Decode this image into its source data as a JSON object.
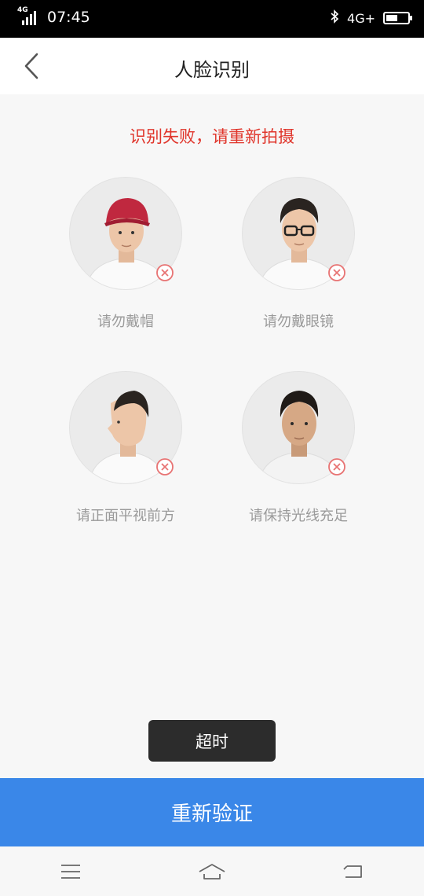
{
  "status_bar": {
    "network_left": "4G",
    "time": "07:45",
    "network_right": "4G+",
    "battery_level": 0.55
  },
  "nav": {
    "title": "人脸识别"
  },
  "error_message": "识别失败，请重新拍摄",
  "tips": [
    {
      "label": "请勿戴帽",
      "icon": "person-with-cap"
    },
    {
      "label": "请勿戴眼镜",
      "icon": "person-with-glasses"
    },
    {
      "label": "请正面平视前方",
      "icon": "person-profile"
    },
    {
      "label": "请保持光线充足",
      "icon": "person-dim-light"
    }
  ],
  "toast": "超时",
  "retry_button": "重新验证",
  "colors": {
    "error": "#e0352b",
    "primary": "#3a87e8",
    "x_mark": "#e87474"
  }
}
